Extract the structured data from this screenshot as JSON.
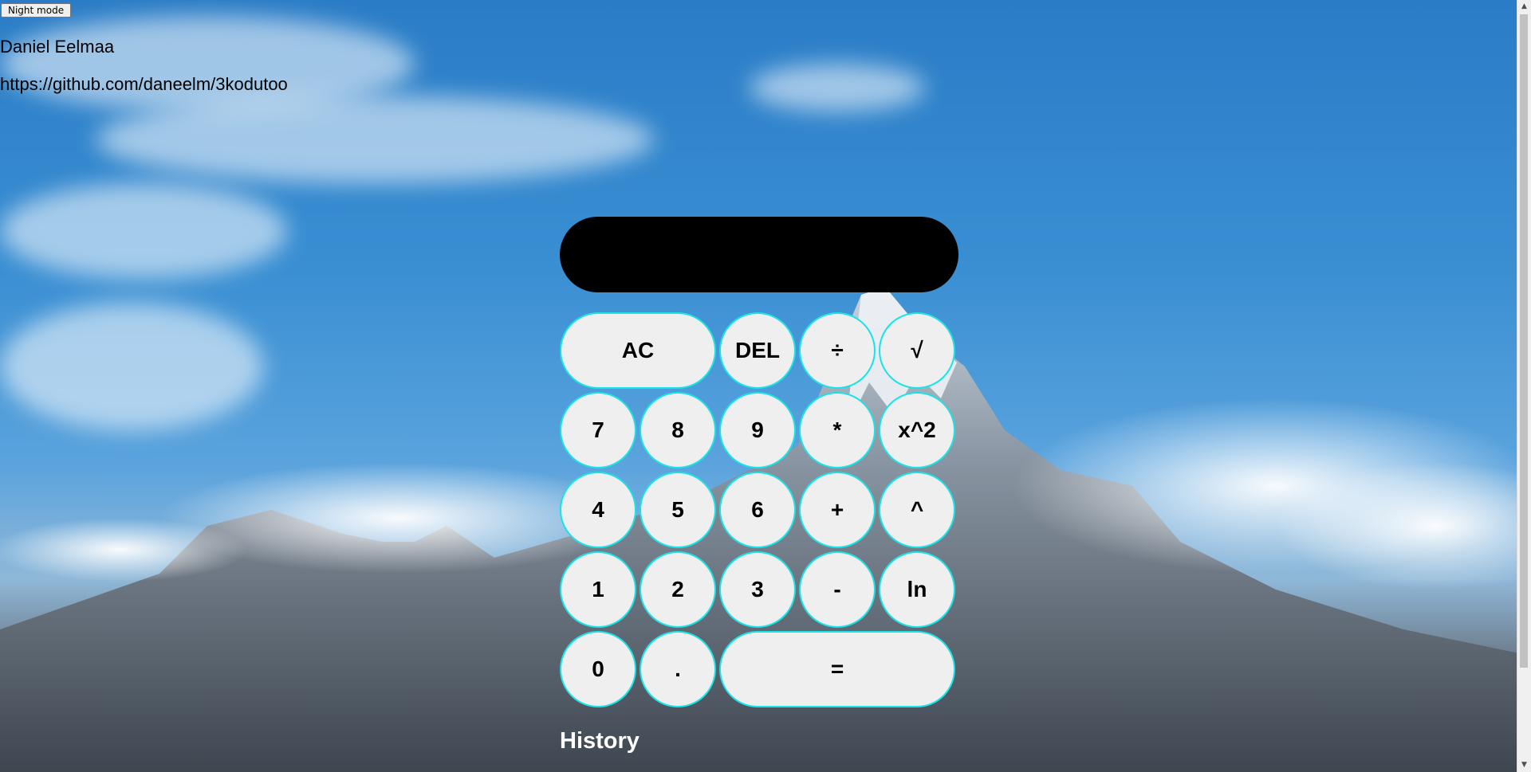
{
  "header": {
    "night_mode_label": "Night mode",
    "author": "Daniel Eelmaa",
    "repo_url": "https://github.com/daneelm/3kodutoo"
  },
  "calculator": {
    "display_value": "",
    "keys": [
      {
        "label": "AC",
        "name": "clear-button"
      },
      {
        "label": "DEL",
        "name": "delete-button"
      },
      {
        "label": "÷",
        "name": "divide-button"
      },
      {
        "label": "√",
        "name": "sqrt-button"
      },
      {
        "label": "7",
        "name": "digit-7-button"
      },
      {
        "label": "8",
        "name": "digit-8-button"
      },
      {
        "label": "9",
        "name": "digit-9-button"
      },
      {
        "label": "*",
        "name": "multiply-button"
      },
      {
        "label": "x^2",
        "name": "square-button"
      },
      {
        "label": "4",
        "name": "digit-4-button"
      },
      {
        "label": "5",
        "name": "digit-5-button"
      },
      {
        "label": "6",
        "name": "digit-6-button"
      },
      {
        "label": "+",
        "name": "add-button"
      },
      {
        "label": "^",
        "name": "power-button"
      },
      {
        "label": "1",
        "name": "digit-1-button"
      },
      {
        "label": "2",
        "name": "digit-2-button"
      },
      {
        "label": "3",
        "name": "digit-3-button"
      },
      {
        "label": "-",
        "name": "subtract-button"
      },
      {
        "label": "ln",
        "name": "ln-button"
      },
      {
        "label": "0",
        "name": "digit-0-button"
      },
      {
        "label": ".",
        "name": "decimal-button"
      },
      {
        "label": "=",
        "name": "equals-button"
      }
    ]
  },
  "history": {
    "title": "History"
  },
  "colors": {
    "key_border": "#18e4e8",
    "key_background": "#efefef",
    "display_background": "#000000"
  },
  "icons": {
    "scroll_up": "chevron-up-icon",
    "scroll_down": "chevron-down-icon"
  }
}
